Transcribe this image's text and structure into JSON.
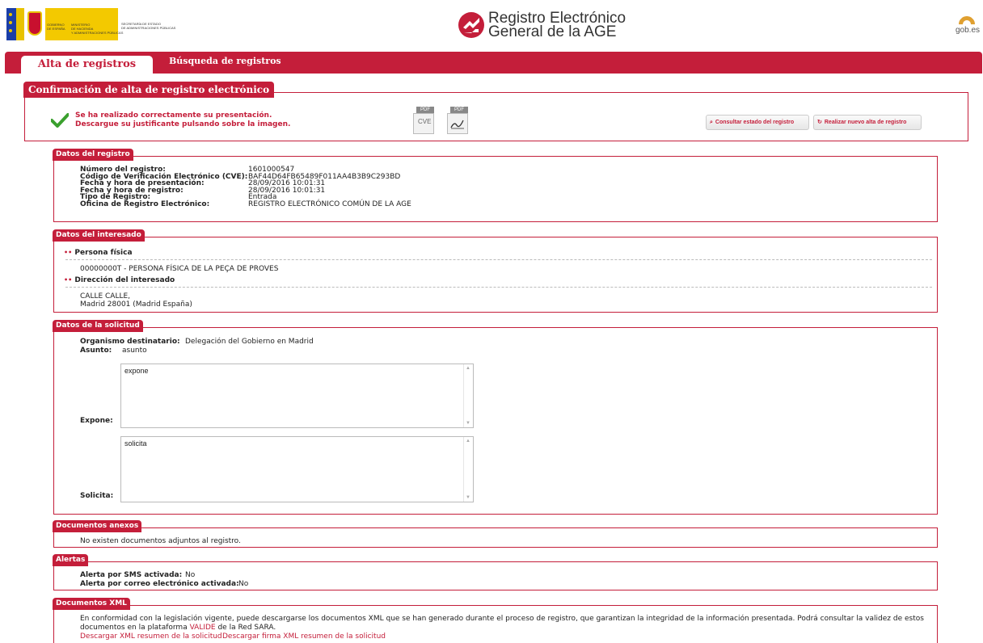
{
  "header": {
    "gov_col1": "GOBIERNO\nDE ESPAÑA",
    "gov_col2": "MINISTERIO\nDE HACIENDA\nY ADMINISTRACIONES PÚBLICAS",
    "gov_col3": "SECRETARÍA DE ESTADO\nDE ADMINISTRACIONES PÚBLICAS",
    "brand_line1": "Registro Electrónico",
    "brand_line2": "General de la AGE",
    "gobes": "gob.es",
    "brand_color": "#c41e3a"
  },
  "nav": {
    "tab_active": "Alta de registros",
    "tab_search": "Búsqueda de registros"
  },
  "confirm": {
    "title": "Confirmación de alta de registro electrónico",
    "msg1": "Se ha realizado correctamente su presentación.",
    "msg2": "Descargue su justificante pulsando sobre la imagen.",
    "pdf1_tag": "PDF",
    "pdf1_label": "CVE",
    "pdf2_tag": "PDF",
    "btn_status": "Consultar estado del registro",
    "btn_new": "Realizar nuevo alta de registro"
  },
  "datos_registro": {
    "title": "Datos del registro",
    "rows": [
      {
        "label": "Número del registro:",
        "value": "1601000547"
      },
      {
        "label": "Código de Verificación Electrónico (CVE):",
        "value": "BAF44D64FB65489F011AA4B3B9C293BD"
      },
      {
        "label": "Fecha y hora de presentación:",
        "value": "28/09/2016 10:01:31"
      },
      {
        "label": "Fecha y hora de registro:",
        "value": "28/09/2016 10:01:31"
      },
      {
        "label": "Tipo de Registro:",
        "value": "Entrada"
      },
      {
        "label": "Oficina de Registro Electrónico:",
        "value": "REGISTRO ELECTRÓNICO COMÚN DE LA AGE"
      }
    ]
  },
  "interesado": {
    "title": "Datos del interesado",
    "persona_title": "Persona física",
    "persona_value": "00000000T - PERSONA FÍSICA DE LA PEÇA DE PROVES",
    "direccion_title": "Dirección del interesado",
    "direccion_line1": "CALLE CALLE,",
    "direccion_line2": "Madrid 28001 (Madrid España)"
  },
  "solicitud": {
    "title": "Datos de la solicitud",
    "organismo_label": "Organismo destinatario:",
    "organismo_value": "Delegación del Gobierno en Madrid",
    "asunto_label": "Asunto:",
    "asunto_value": "asunto",
    "expone_label": "Expone:",
    "expone_value": "expone",
    "solicita_label": "Solicita:",
    "solicita_value": "solicita"
  },
  "anexos": {
    "title": "Documentos anexos",
    "text": "No existen documentos adjuntos al registro."
  },
  "alertas": {
    "title": "Alertas",
    "sms_label": "Alerta por SMS activada:",
    "sms_value": "No",
    "mail_label": "Alerta por correo electrónico activada:",
    "mail_value": "No"
  },
  "xml": {
    "title": "Documentos XML",
    "text1": "En conformidad con la legislación vigente, puede descargarse los documentos XML que se han generado durante el proceso de registro, que garantizan la integridad de la información presentada. Podrá consultar la validez de estos",
    "text2a": "documentos en la plataforma ",
    "text2_link": "VALIDE",
    "text2b": " de la Red SARA.",
    "link1": "Descargar XML resumen de la solicitud",
    "link2": "Descargar firma XML resumen de la solicitud"
  }
}
